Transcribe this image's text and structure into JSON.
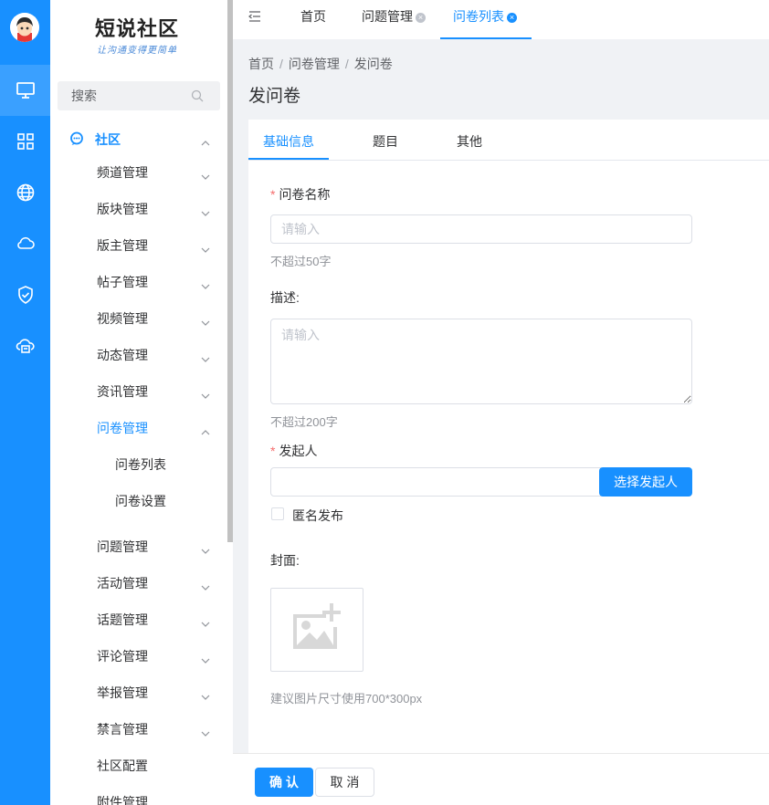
{
  "colors": {
    "primary": "#1890ff",
    "required": "#f56c6c",
    "rail": "#1890ff"
  },
  "rail": {
    "icons": [
      "avatar",
      "monitor-icon",
      "grid-icon",
      "globe-icon",
      "cloud-icon",
      "shield-check-icon",
      "cloud-printer-icon"
    ]
  },
  "brand": {
    "title": "短说社区",
    "subtitle": "让沟通变得更简单"
  },
  "search": {
    "placeholder": "搜索"
  },
  "menu": {
    "root": "社区",
    "items": [
      "频道管理",
      "版块管理",
      "版主管理",
      "帖子管理",
      "视频管理",
      "动态管理",
      "资讯管理",
      "问卷管理"
    ],
    "subitems": [
      "问卷列表",
      "问卷设置"
    ],
    "items_after": [
      "问题管理",
      "活动管理",
      "话题管理",
      "评论管理",
      "举报管理",
      "禁言管理",
      "社区配置",
      "附件管理"
    ]
  },
  "tabs": [
    "首页",
    "问题管理",
    "问卷列表"
  ],
  "breadcrumb": [
    "首页",
    "问卷管理",
    "发问卷"
  ],
  "page_title": "发问卷",
  "form_tabs": [
    "基础信息",
    "题目",
    "其他"
  ],
  "form": {
    "name_label": "问卷名称",
    "name_placeholder": "请输入",
    "name_hint": "不超过50字",
    "desc_label": "描述:",
    "desc_placeholder": "请输入",
    "desc_hint": "不超过200字",
    "initiator_label": "发起人",
    "initiator_value": "",
    "select_initiator": "选择发起人",
    "anonymous_label": "匿名发布",
    "cover_label": "封面:",
    "cover_hint": "建议图片尺寸使用700*300px"
  },
  "footer": {
    "confirm": "确 认",
    "cancel": "取 消"
  }
}
